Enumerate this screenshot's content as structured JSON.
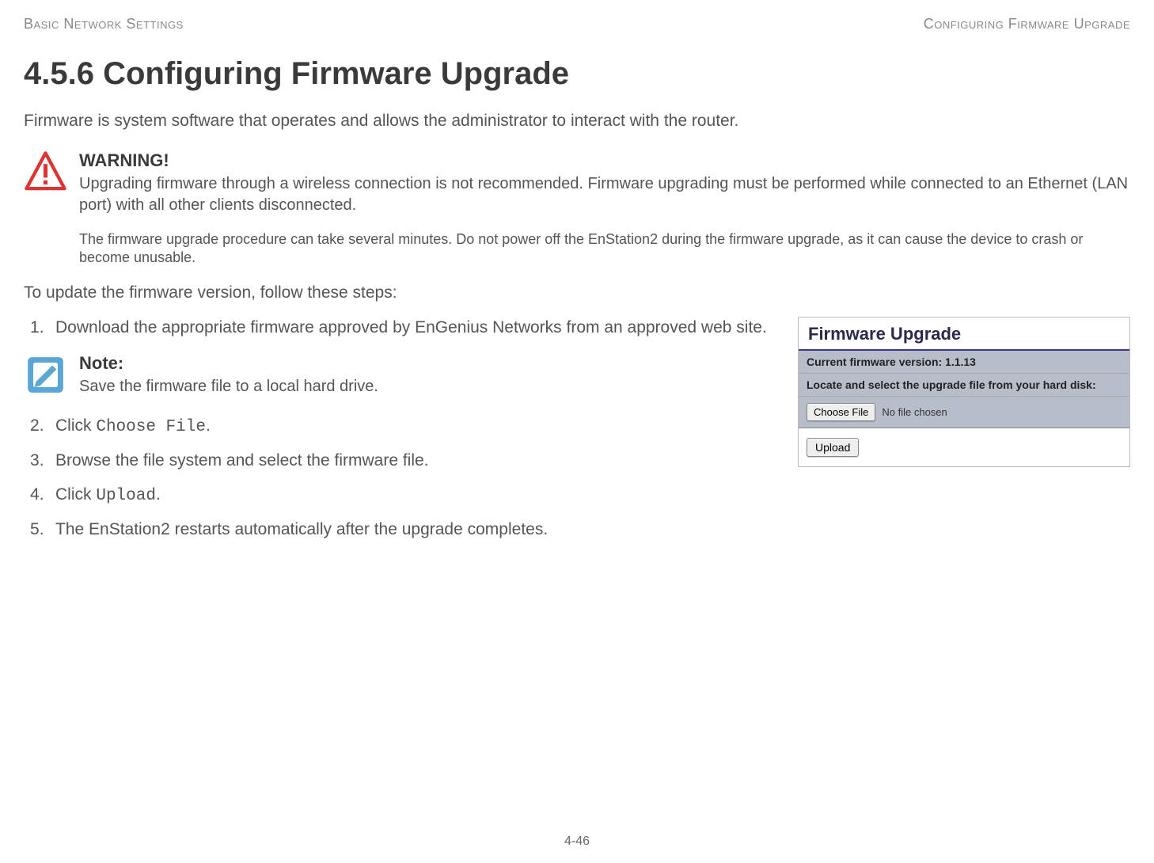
{
  "header": {
    "left": "Basic Network Settings",
    "right": "Configuring Firmware Upgrade"
  },
  "title": "4.5.6 Configuring Firmware Upgrade",
  "intro": "Firmware is system software that operates and allows the administrator to interact with the router.",
  "warning": {
    "title": "WARNING!",
    "text": "Upgrading firmware through a wireless connection is not recommended. Firmware upgrading must be performed while connected to an Ethernet (LAN port) with all other clients disconnected.",
    "sub": "The firmware upgrade procedure can take several minutes. Do not power off the EnStation2 during the firmware upgrade, as it can cause the device to crash or become unusable."
  },
  "lead_in": "To update the firmware version, follow these steps:",
  "steps": {
    "s1": "Download the appropriate firmware approved by EnGenius Networks from an approved web site.",
    "s2_pre": "Click ",
    "s2_code": "Choose File",
    "s2_post": ".",
    "s3": "Browse the file system and select the firmware file.",
    "s4_pre": "Click ",
    "s4_code": "Upload",
    "s4_post": ".",
    "s5": "The EnStation2 restarts automatically after the upgrade completes."
  },
  "note": {
    "title": "Note:",
    "text": "Save the firmware file to a local hard drive."
  },
  "panel": {
    "heading": "Firmware Upgrade",
    "version_row": "Current firmware version: 1.1.13",
    "locate_row": "Locate and select the upgrade file from your hard disk:",
    "choose_file": "Choose File",
    "no_file": "No file chosen",
    "upload": "Upload"
  },
  "page_number": "4-46"
}
